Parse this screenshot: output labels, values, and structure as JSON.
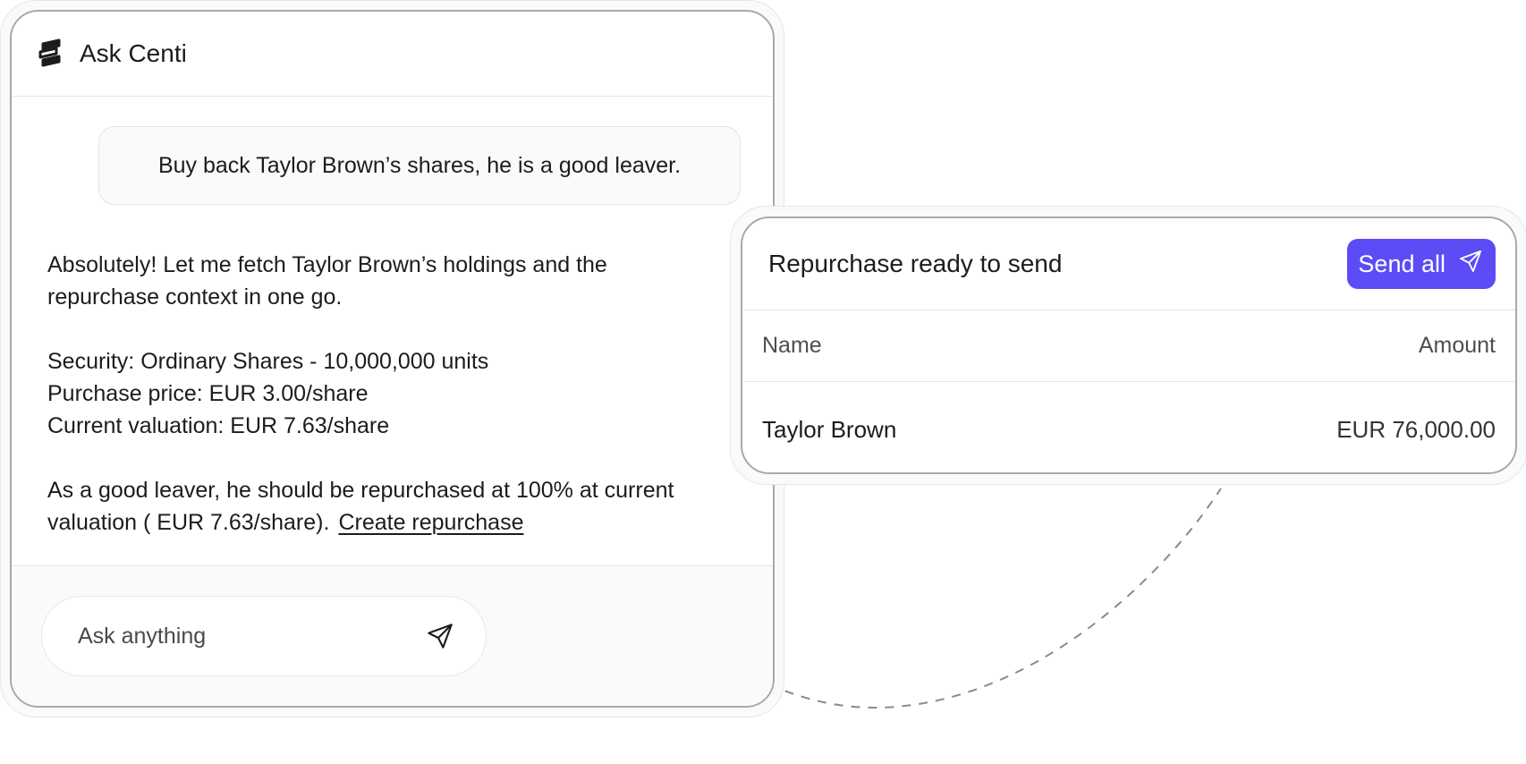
{
  "chat": {
    "title": "Ask Centi",
    "logo_icon": "centi-logo-icon",
    "user_message": "Buy back Taylor Brown’s shares, he is a good leaver.",
    "assistant": {
      "intro_line_1": "Absolutely! Let me fetch Taylor Brown’s holdings and the",
      "intro_line_2": "repurchase context in one go.",
      "security": "Security: Ordinary Shares - 10,000,000 units",
      "purchase_price": "Purchase price: EUR 3.00/share",
      "current_valuation": "Current valuation: EUR 7.63/share",
      "conclusion_line_1": "As a good leaver, he should be repurchased at 100% at current",
      "conclusion_line_2": "valuation ( EUR 7.63/share).",
      "action_link": "Create repurchase"
    },
    "input": {
      "placeholder": "Ask anything",
      "send_icon": "paper-plane-icon"
    }
  },
  "repurchase_card": {
    "title": "Repurchase ready to send",
    "send_all_label": "Send all",
    "send_all_icon": "paper-plane-icon",
    "columns": {
      "name": "Name",
      "amount": "Amount"
    },
    "rows": [
      {
        "name": "Taylor Brown",
        "amount": "EUR 76,000.00"
      }
    ]
  },
  "colors": {
    "accent": "#5b4cf5",
    "panel_border": "#a9a9a9",
    "divider": "#e6e6e6",
    "text": "#1c1c1c"
  }
}
